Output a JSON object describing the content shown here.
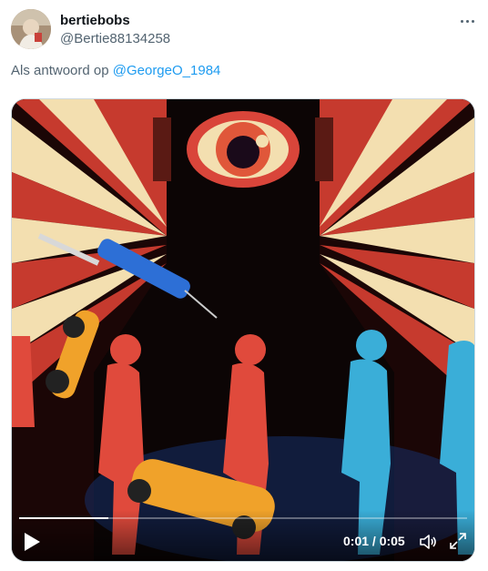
{
  "tweet": {
    "display_name": "bertiebobs",
    "handle": "@Bertie88134258",
    "reply_prefix": "Als antwoord op ",
    "reply_to": "@GeorgeO_1984",
    "more_icon": "more-horizontal-icon"
  },
  "video": {
    "time": "0:01 / 0:05",
    "progress": 0.2,
    "play_icon": "play-icon",
    "volume_icon": "volume-icon",
    "fullscreen_icon": "fullscreen-icon"
  },
  "colors": {
    "accent": "#1d9bf0",
    "poster_red": "#d9453a",
    "poster_cream": "#f3dfb0",
    "poster_blue": "#3aaed8",
    "poster_orange": "#f0a22a"
  }
}
